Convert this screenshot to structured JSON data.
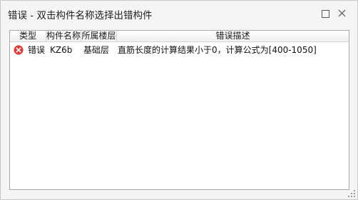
{
  "window": {
    "title": "错误 - 双击构件名称选择出错构件"
  },
  "table": {
    "columns": {
      "type": "类型",
      "name": "构件名称",
      "floor": "所属楼层",
      "desc": "错误描述"
    },
    "rows": [
      {
        "icon": "error-icon",
        "type": "错误",
        "name": "KZ6b",
        "floor": "基础层",
        "desc": "直筋长度的计算结果小于0，计算公式为[400-1050]"
      }
    ]
  },
  "colors": {
    "error_icon": "#d9403a"
  }
}
